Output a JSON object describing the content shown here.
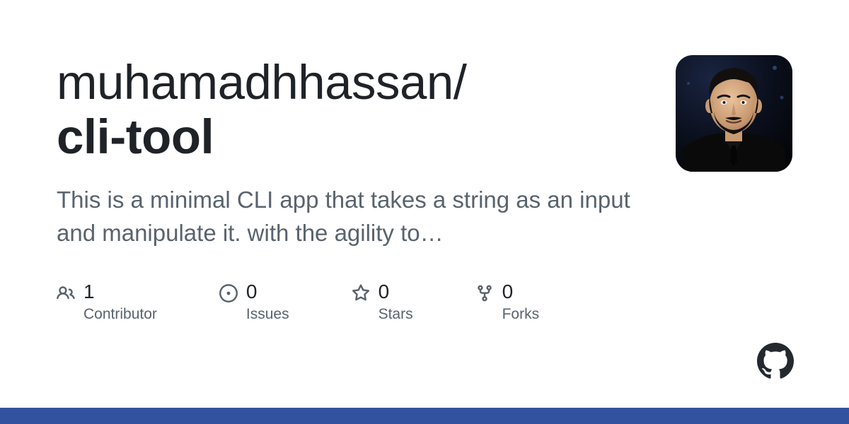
{
  "owner": "muhamadhhassan",
  "separator": "/",
  "repo": "cli-tool",
  "description": "This is a minimal CLI app that takes a string as an input and manipulate it. with the agility to…",
  "stats": {
    "contributors": {
      "count": "1",
      "label": "Contributor"
    },
    "issues": {
      "count": "0",
      "label": "Issues"
    },
    "stars": {
      "count": "0",
      "label": "Stars"
    },
    "forks": {
      "count": "0",
      "label": "Forks"
    }
  },
  "accent_color": "#32529f"
}
